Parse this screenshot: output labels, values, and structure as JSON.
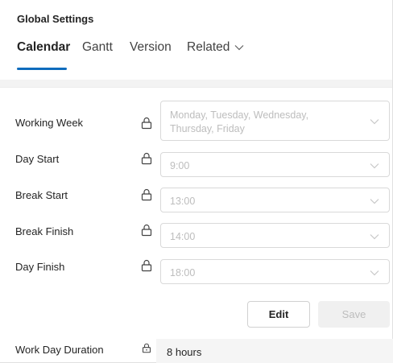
{
  "header": {
    "title": "Global Settings"
  },
  "tabs": [
    {
      "label": "Calendar",
      "active": true
    },
    {
      "label": "Gantt",
      "active": false
    },
    {
      "label": "Version",
      "active": false
    },
    {
      "label": "Related",
      "active": false,
      "has_dropdown": true
    }
  ],
  "settings": [
    {
      "label": "Working Week",
      "value_line1": "Monday, Tuesday, Wednesday,",
      "value_line2": "Thursday, Friday",
      "locked": true
    },
    {
      "label": "Day Start",
      "value": "9:00",
      "locked": true
    },
    {
      "label": "Break Start",
      "value": "13:00",
      "locked": true
    },
    {
      "label": "Break Finish",
      "value": "14:00",
      "locked": true
    },
    {
      "label": "Day Finish",
      "value": "18:00",
      "locked": true
    }
  ],
  "actions": {
    "edit_label": "Edit",
    "save_label": "Save",
    "save_disabled": true
  },
  "work_day_duration": {
    "label": "Work Day Duration",
    "value": "8 hours",
    "locked": true
  },
  "colors": {
    "accent": "#0f6cbd",
    "disabled_text": "#bdbdbd",
    "text": "#242424"
  }
}
